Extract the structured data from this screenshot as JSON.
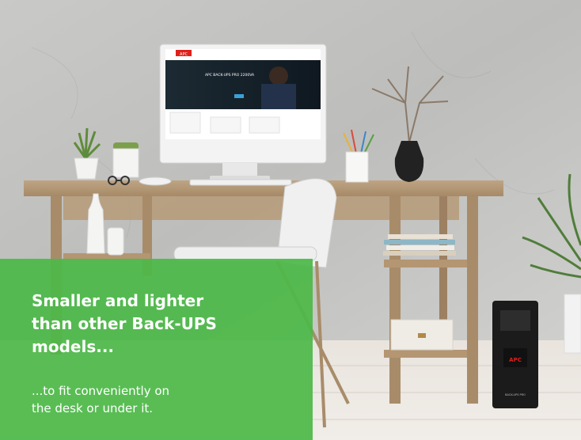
{
  "brand": {
    "name": "APC",
    "color": "#e0201b"
  },
  "banner": {
    "headline_lines": [
      "Smaller and lighter",
      "than other Back-UPS",
      "models..."
    ],
    "subline_lines": [
      "...to fit conveniently on",
      "the desk or under it."
    ],
    "overlay_color": "#4cb948"
  },
  "monitor_screen": {
    "logo_text": "APC",
    "hero_text": "APC BACK-UPS PRO 2200VA"
  },
  "ups_device": {
    "logo_text": "APC",
    "model_text": "BACK-UPS PRO"
  }
}
